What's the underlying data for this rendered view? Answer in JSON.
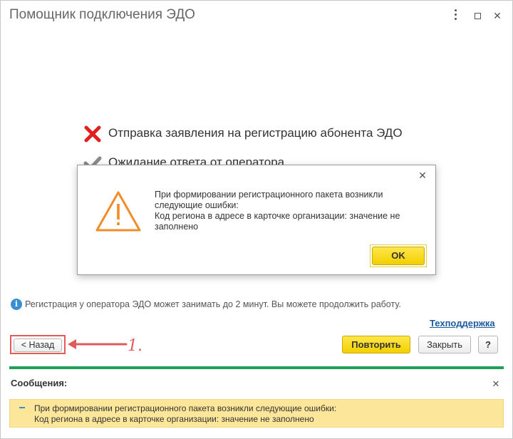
{
  "window": {
    "title": "Помощник подключения ЭДО"
  },
  "steps": [
    {
      "text": "Отправка заявления на регистрацию абонента ЭДО",
      "status": "error"
    },
    {
      "text": "Ожидание ответа от оператора",
      "status": "done"
    }
  ],
  "info": {
    "text": "Регистрация у оператора ЭДО может занимать до 2 минут. Вы можете продолжить работу."
  },
  "links": {
    "support": "Техподдержка"
  },
  "buttons": {
    "back": "< Назад",
    "repeat": "Повторить",
    "close": "Закрыть",
    "help": "?"
  },
  "annotation": {
    "label": "1."
  },
  "messages": {
    "title": "Сообщения:",
    "items": [
      {
        "line1": "При формировании регистрационного пакета возникли следующие ошибки:",
        "line2": "Код региона в адресе в карточке организации: значение не заполнено"
      }
    ]
  },
  "dialog": {
    "lines": [
      "При формировании регистрационного пакета возникли",
      "следующие ошибки:",
      "Код региона в адресе в карточке организации: значение не",
      "заполнено"
    ],
    "ok_label": "OK"
  },
  "colors": {
    "accent_yellow": "#f2cf00",
    "error_red": "#e02020",
    "done_gray": "#8a8a8a",
    "warning_orange": "#f28c28",
    "separator_green": "#1ea05a",
    "annotation_red": "#e35a5a",
    "link_blue": "#1e5b9e"
  }
}
